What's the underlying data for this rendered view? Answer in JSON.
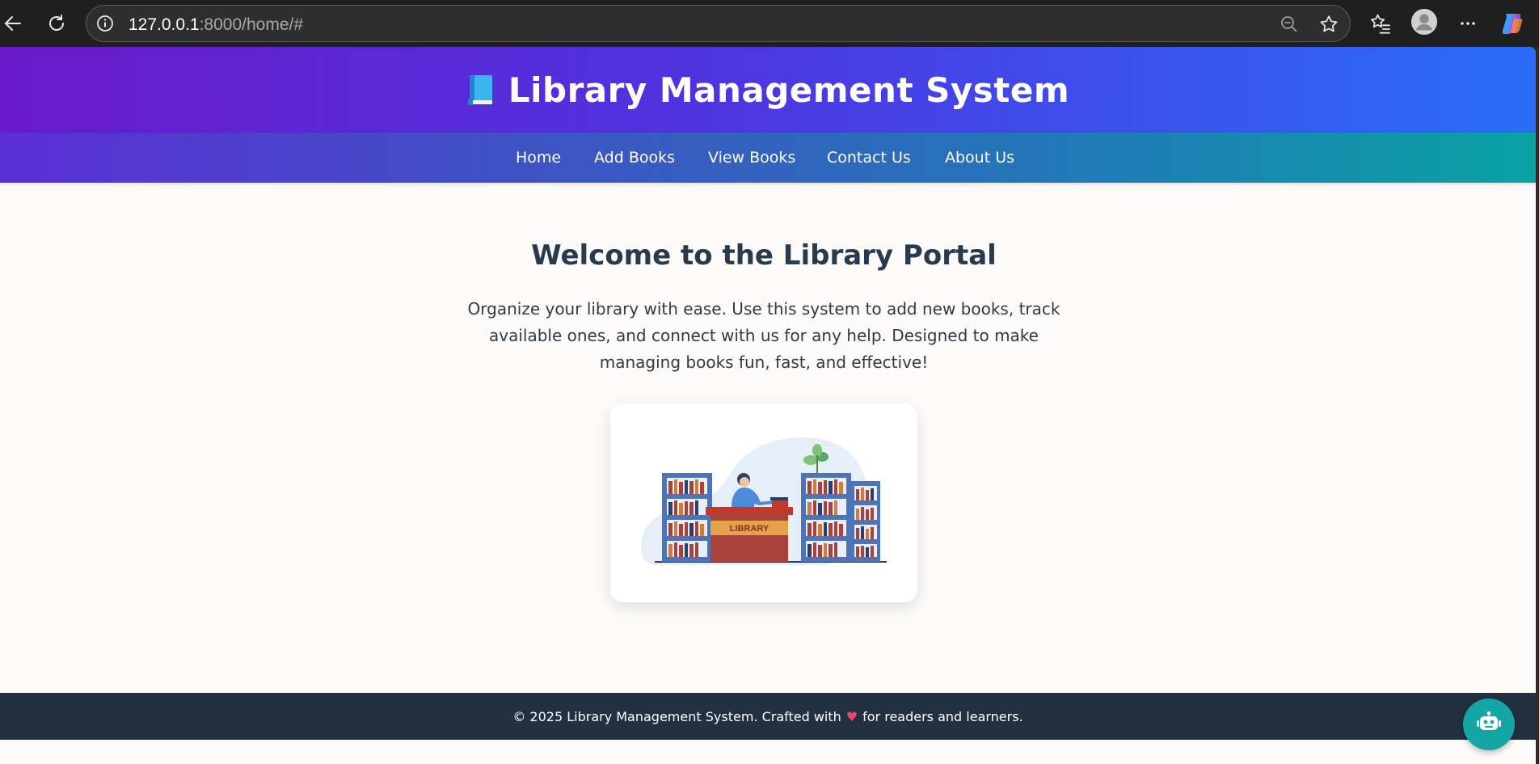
{
  "browser": {
    "url_host": "127.0.0.1",
    "url_rest": ":8000/home/#",
    "icons": [
      "back-arrow-icon",
      "reload-icon",
      "info-icon",
      "zoom-out-icon",
      "favorite-star-icon",
      "favorites-list-icon",
      "profile-avatar-icon",
      "more-options-icon",
      "copilot-icon"
    ]
  },
  "header": {
    "icon": "blue-book-emoji",
    "title": "Library Management System"
  },
  "nav": {
    "items": [
      {
        "label": "Home"
      },
      {
        "label": "Add Books"
      },
      {
        "label": "View Books"
      },
      {
        "label": "Contact Us"
      },
      {
        "label": "About Us"
      }
    ]
  },
  "main": {
    "heading": "Welcome to the Library Portal",
    "intro": "Organize your library with ease. Use this system to add new books, track available ones, and connect with us for any help. Designed to make managing books fun, fast, and effective!",
    "illustration": {
      "desk_sign": "LIBRARY"
    }
  },
  "footer": {
    "text_before": "© 2025 Library Management System. Crafted with",
    "heart": "♥",
    "text_after": "for readers and learners."
  },
  "chatbot": {
    "icon": "robot-icon"
  },
  "colors": {
    "header_gradient_start": "#6a1ac9",
    "header_gradient_end": "#2a6cf9",
    "nav_gradient_end": "#0aa2a3",
    "footer_bg": "#22303f",
    "heading_color": "#2a3a4d",
    "chatbot_bg": "#13a6a4"
  }
}
